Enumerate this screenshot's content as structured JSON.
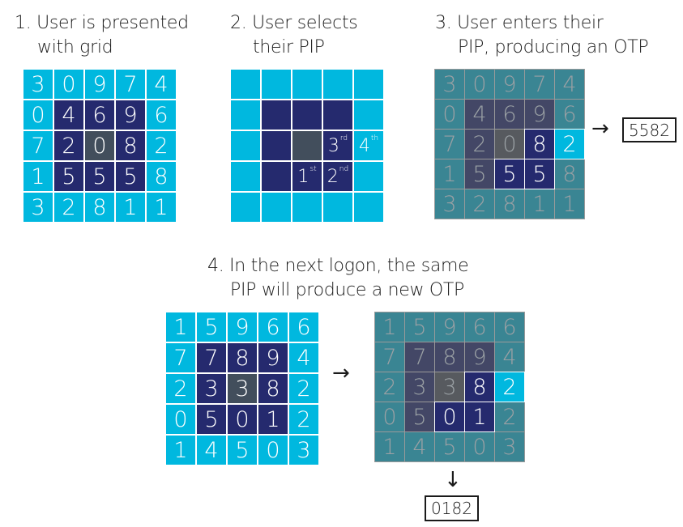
{
  "colors": {
    "cyan": "#00b8df",
    "navy": "#252a6e",
    "center": "#424e5c",
    "dim_teal": "#3a8593",
    "dim_navy": "#434766",
    "dim_center": "#575a5f"
  },
  "step1": {
    "title_line1": "1. User is presented",
    "title_line2": "with grid",
    "grid": [
      [
        "3",
        "0",
        "9",
        "7",
        "4"
      ],
      [
        "0",
        "4",
        "6",
        "9",
        "6"
      ],
      [
        "7",
        "2",
        "0",
        "8",
        "2"
      ],
      [
        "1",
        "5",
        "5",
        "5",
        "8"
      ],
      [
        "3",
        "2",
        "8",
        "1",
        "1"
      ]
    ]
  },
  "step2": {
    "title_line1": "2. User selects",
    "title_line2": "their PIP",
    "pip": [
      {
        "num": "1",
        "suffix": "st",
        "row": 3,
        "col": 2
      },
      {
        "num": "2",
        "suffix": "nd",
        "row": 3,
        "col": 3
      },
      {
        "num": "3",
        "suffix": "rd",
        "row": 2,
        "col": 3
      },
      {
        "num": "4",
        "suffix": "th",
        "row": 2,
        "col": 4
      }
    ]
  },
  "step3": {
    "title_line1": "3. User enters their",
    "title_line2": "PIP, producing an OTP",
    "otp": "5582",
    "arrow": "→"
  },
  "step4": {
    "title_line1": "4. In the next logon, the same",
    "title_line2": "PIP will produce a new OTP",
    "grid": [
      [
        "1",
        "5",
        "9",
        "6",
        "6"
      ],
      [
        "7",
        "7",
        "8",
        "9",
        "4"
      ],
      [
        "2",
        "3",
        "3",
        "8",
        "2"
      ],
      [
        "0",
        "5",
        "0",
        "1",
        "2"
      ],
      [
        "1",
        "4",
        "5",
        "0",
        "3"
      ]
    ],
    "otp": "0182",
    "arrow_right": "→",
    "arrow_down": "↓"
  },
  "layout_roles": [
    [
      "cyan",
      "cyan",
      "cyan",
      "cyan",
      "cyan"
    ],
    [
      "cyan",
      "navy",
      "navy",
      "navy",
      "cyan"
    ],
    [
      "cyan",
      "navy",
      "center",
      "navy",
      "cyan"
    ],
    [
      "cyan",
      "navy",
      "navy",
      "navy",
      "cyan"
    ],
    [
      "cyan",
      "cyan",
      "cyan",
      "cyan",
      "cyan"
    ]
  ],
  "pip_cells": [
    [
      3,
      2
    ],
    [
      3,
      3
    ],
    [
      2,
      3
    ],
    [
      2,
      4
    ]
  ]
}
